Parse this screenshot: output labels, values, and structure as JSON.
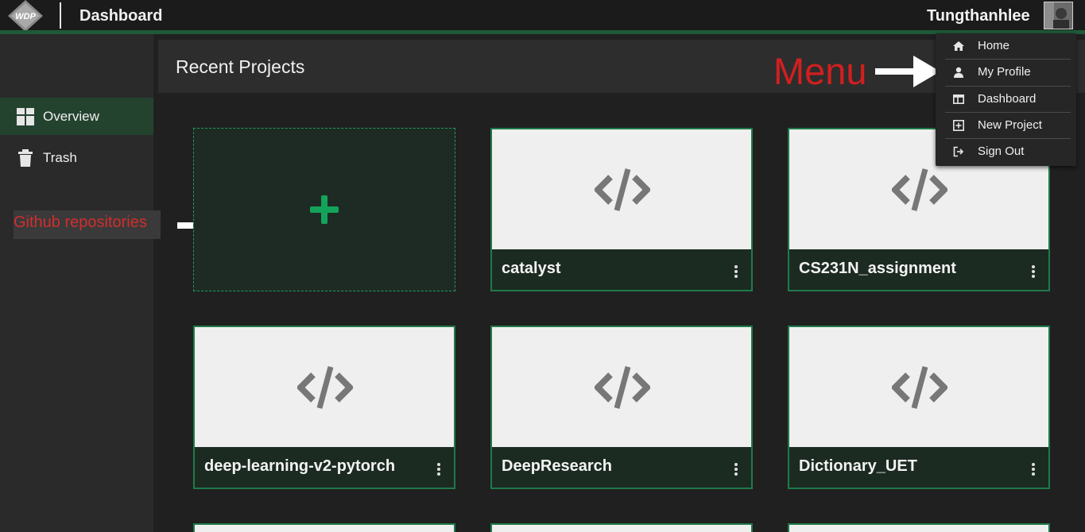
{
  "header": {
    "app_title": "Dashboard",
    "username": "Tungthanhlee",
    "logo_text": "WDP"
  },
  "sidebar": {
    "items": [
      {
        "label": "Overview",
        "icon": "grid-icon",
        "active": true
      },
      {
        "label": "Trash",
        "icon": "trash-icon",
        "active": false
      }
    ]
  },
  "annotations": {
    "github_label": "Github repositories",
    "menu_label": "Menu"
  },
  "main": {
    "title": "Recent Projects",
    "new_project_icon": "plus-icon",
    "projects": [
      {
        "name": "catalyst"
      },
      {
        "name": "CS231N_assignment"
      },
      {
        "name": "deep-learning-v2-pytorch"
      },
      {
        "name": "DeepResearch"
      },
      {
        "name": "Dictionary_UET"
      }
    ]
  },
  "user_menu": {
    "items": [
      {
        "label": "Home",
        "icon": "home-icon"
      },
      {
        "label": "My Profile",
        "icon": "user-icon"
      },
      {
        "label": "Dashboard",
        "icon": "dashboard-icon"
      },
      {
        "label": "New Project",
        "icon": "plus-square-icon"
      },
      {
        "label": "Sign Out",
        "icon": "sign-out-icon"
      }
    ]
  },
  "colors": {
    "accent": "#1f9a5a",
    "annotation_red": "#d22d2d",
    "background": "#202020"
  }
}
